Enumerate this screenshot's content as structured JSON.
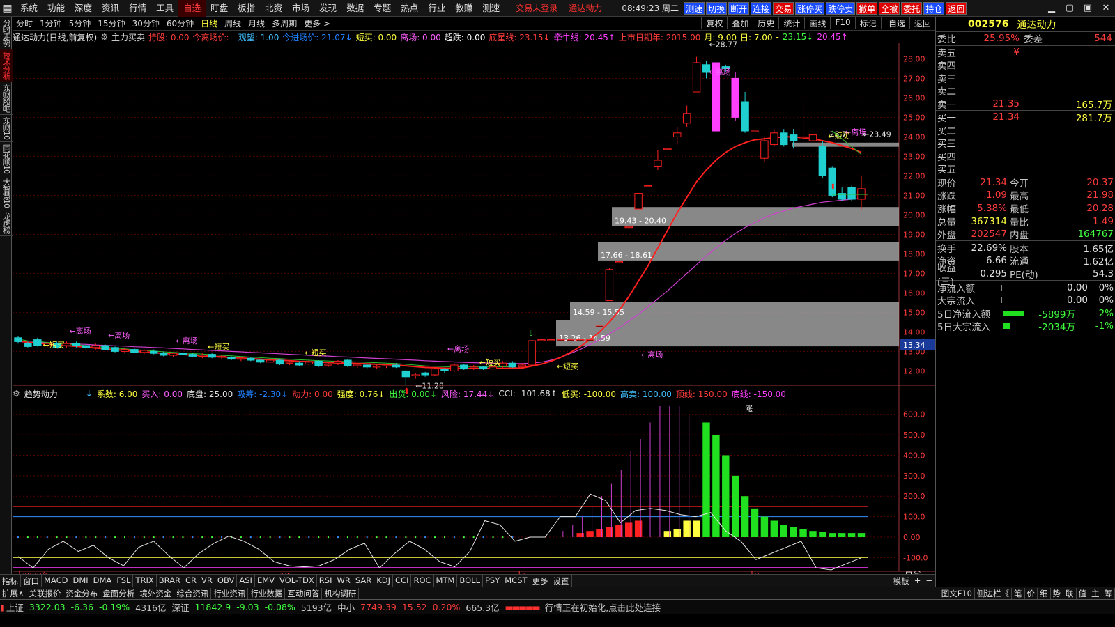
{
  "menu": {
    "items": [
      "系统",
      "功能",
      "深度",
      "资讯",
      "行情",
      "工具",
      "自选",
      "盯盘",
      "板指",
      "北资",
      "市场",
      "发现",
      "数据",
      "专题",
      "热点",
      "行业",
      "教赚",
      "测速"
    ],
    "active": "自选",
    "status1": "交易未登录",
    "status2": "通达动力",
    "clock": "08:49:23",
    "weekday": "周二",
    "quick": [
      "测速",
      "切换",
      "断开",
      "连接",
      "交易",
      "涨停买",
      "跌停卖",
      "撤单",
      "全撤",
      "委托",
      "持仓",
      "返回"
    ],
    "win": [
      "▁",
      "▢",
      "▣",
      "✕"
    ]
  },
  "lefttabs": [
    "分时走势",
    "技术分析",
    "东财股吧",
    "东财10",
    "同花顺10",
    "大智慧10",
    "龙虎榜"
  ],
  "lefttab_active": "技术分析",
  "periods": [
    "分时",
    "1分钟",
    "5分钟",
    "15分钟",
    "30分钟",
    "60分钟",
    "日线",
    "周线",
    "月线",
    "多周期",
    "更多 >"
  ],
  "period_active": "日线",
  "rbuttons": [
    "复权",
    "叠加",
    "历史",
    "统计",
    "画线",
    "F10",
    "标记",
    "-自选",
    "返回"
  ],
  "info": {
    "name": "通达动力(日线,前复权)",
    "fields": [
      {
        "t": "主力买卖",
        "c": "#e0e0e0"
      },
      {
        "t": "持股: 0.00",
        "c": "#ff3c3c"
      },
      {
        "t": "今离场价: -",
        "c": "#ff3c3c"
      },
      {
        "t": "观望: 1.00",
        "c": "#40c0ff"
      },
      {
        "t": "今进场价: 21.07↓",
        "c": "#2080ff"
      },
      {
        "t": "短买: 0.00",
        "c": "#ffff40"
      },
      {
        "t": "离场: 0.00",
        "c": "#ff60ff"
      },
      {
        "t": "超跌: 0.00",
        "c": "#ffffff"
      },
      {
        "t": "底星线: 23.15↓",
        "c": "#ff3c3c"
      },
      {
        "t": "牵牛线: 20.45↑",
        "c": "#ff40ff"
      },
      {
        "t": "上市日期年: 2015.00",
        "c": "#ff3c3c"
      },
      {
        "t": "月: 9.00",
        "c": "#ffff40"
      },
      {
        "t": "日: 7.00",
        "c": "#ffff40"
      },
      {
        "t": "-",
        "c": "#ffff40"
      },
      {
        "t": "23.15↓",
        "c": "#40ff40"
      },
      {
        "t": "20.45↑",
        "c": "#ff40ff"
      }
    ]
  },
  "indicator": {
    "name": "趋势动力",
    "fields": [
      {
        "t": "↓",
        "c": "#40c0ff"
      },
      {
        "t": "系数: 6.00",
        "c": "#ffff40"
      },
      {
        "t": "买入: 0.00",
        "c": "#ff60ff"
      },
      {
        "t": "底盘: 25.00",
        "c": "#e0e0e0"
      },
      {
        "t": "吸筹: -2.30↓",
        "c": "#2080ff"
      },
      {
        "t": "动力: 0.00",
        "c": "#ff3c3c"
      },
      {
        "t": "强度: 0.76↓",
        "c": "#ffff40"
      },
      {
        "t": "出货: 0.00↓",
        "c": "#40ff40"
      },
      {
        "t": "风险: 17.44↓",
        "c": "#ff60ff"
      },
      {
        "t": "CCI: -101.68↑",
        "c": "#e0e0e0"
      },
      {
        "t": "低买: -100.00",
        "c": "#ffff40"
      },
      {
        "t": "高卖: 100.00",
        "c": "#40c0ff"
      },
      {
        "t": "顶线: 150.00",
        "c": "#ff3c3c"
      },
      {
        "t": "底线: -150.00",
        "c": "#ff40ff"
      }
    ]
  },
  "chart_data": {
    "type": "candlestick",
    "y_ticks": [
      "28.00",
      "27.00",
      "26.00",
      "25.00",
      "24.00",
      "23.00",
      "22.00",
      "21.00",
      "20.00",
      "19.00",
      "18.00",
      "17.00",
      "16.00",
      "15.00",
      "14.00",
      "13.00",
      "12.00"
    ],
    "x_labels": [
      "2022年",
      "12",
      "1",
      "2"
    ],
    "current_price_tag": "13.34",
    "candles": [
      [
        13.7,
        13.5,
        13.8,
        13.4
      ],
      [
        13.4,
        13.25,
        13.5,
        13.2
      ],
      [
        13.6,
        13.3,
        13.7,
        13.25
      ],
      [
        13.3,
        13.4,
        13.5,
        13.2
      ],
      [
        13.4,
        13.2,
        13.5,
        13.15
      ],
      [
        13.3,
        13.4,
        13.5,
        13.2
      ],
      [
        13.4,
        13.3,
        13.5,
        13.2
      ],
      [
        13.3,
        13.2,
        13.4,
        13.1
      ],
      [
        13.2,
        13.3,
        13.4,
        13.1
      ],
      [
        13.3,
        13.1,
        13.35,
        13.05
      ],
      [
        13.2,
        13.0,
        13.25,
        12.95
      ],
      [
        13.0,
        13.1,
        13.2,
        12.9
      ],
      [
        13.1,
        12.95,
        13.15,
        12.9
      ],
      [
        12.95,
        13.05,
        13.1,
        12.85
      ],
      [
        13.0,
        12.9,
        13.1,
        12.85
      ],
      [
        12.9,
        12.8,
        13.0,
        12.75
      ],
      [
        12.8,
        12.9,
        12.95,
        12.7
      ],
      [
        12.9,
        12.85,
        13.0,
        12.8
      ],
      [
        12.85,
        12.75,
        12.9,
        12.7
      ],
      [
        12.75,
        12.8,
        12.9,
        12.65
      ],
      [
        12.85,
        12.7,
        12.9,
        12.65
      ],
      [
        12.7,
        12.75,
        12.8,
        12.6
      ],
      [
        12.7,
        12.6,
        12.75,
        12.55
      ],
      [
        12.6,
        12.65,
        12.7,
        12.5
      ],
      [
        12.65,
        12.55,
        12.7,
        12.5
      ],
      [
        12.55,
        12.45,
        12.6,
        12.4
      ],
      [
        12.45,
        12.55,
        12.6,
        12.4
      ],
      [
        12.55,
        12.35,
        12.6,
        12.3
      ],
      [
        12.4,
        12.45,
        12.5,
        12.3
      ],
      [
        12.4,
        12.3,
        12.5,
        12.25
      ],
      [
        12.35,
        12.45,
        12.55,
        12.3
      ],
      [
        12.5,
        12.25,
        12.55,
        12.2
      ],
      [
        12.3,
        12.35,
        12.45,
        12.2
      ],
      [
        12.4,
        12.5,
        12.55,
        12.3
      ],
      [
        12.55,
        12.25,
        12.6,
        12.2
      ],
      [
        12.25,
        12.3,
        12.4,
        12.15
      ],
      [
        12.3,
        12.2,
        12.35,
        12.1
      ],
      [
        12.2,
        12.25,
        12.3,
        12.1
      ],
      [
        12.25,
        12.3,
        12.35,
        12.15
      ],
      [
        12.3,
        12.2,
        12.4,
        12.15
      ],
      [
        12.0,
        11.7,
        12.05,
        11.3
      ],
      [
        11.75,
        11.8,
        11.9,
        11.6
      ],
      [
        11.9,
        11.8,
        11.95,
        11.7
      ],
      [
        11.8,
        12.1,
        12.2,
        11.75
      ],
      [
        12.1,
        12.0,
        12.15,
        11.9
      ],
      [
        12.0,
        12.3,
        12.4,
        11.95
      ],
      [
        12.3,
        12.1,
        12.35,
        12.05
      ],
      [
        12.15,
        12.2,
        12.3,
        12.05
      ],
      [
        12.2,
        12.1,
        12.25,
        12.05
      ],
      [
        12.1,
        12.2,
        12.3,
        12.0
      ],
      [
        12.25,
        12.4,
        12.5,
        12.1
      ],
      [
        12.4,
        12.2,
        12.5,
        12.15
      ],
      [
        12.2,
        12.3,
        12.4,
        12.1
      ],
      [
        12.3,
        13.55,
        13.58,
        12.3
      ],
      [
        13.6,
        13.6,
        13.6,
        13.6
      ],
      [
        13.6,
        13.6,
        13.6,
        13.6
      ],
      [
        13.6,
        13.6,
        13.6,
        13.6
      ],
      [
        13.6,
        13.6,
        13.6,
        13.6
      ],
      [
        13.6,
        13.6,
        13.6,
        13.6
      ],
      [
        13.6,
        13.6,
        13.6,
        13.6
      ],
      [
        14.3,
        14.3,
        14.3,
        14.3
      ],
      [
        15.6,
        17.2,
        17.3,
        15.6
      ],
      [
        17.6,
        17.6,
        17.6,
        17.6
      ],
      [
        19.4,
        19.4,
        19.4,
        19.4
      ],
      [
        20.3,
        21.1,
        21.1,
        20.3
      ],
      [
        21.5,
        21.5,
        21.5,
        21.5
      ],
      [
        22.5,
        22.8,
        23.3,
        22.3
      ],
      [
        23.4,
        23.4,
        23.4,
        23.4
      ],
      [
        24.0,
        24.2,
        24.5,
        23.6
      ],
      [
        24.7,
        25.2,
        25.6,
        24.5
      ],
      [
        26.3,
        27.8,
        28.1,
        26.3
      ],
      [
        27.7,
        27.3,
        27.9,
        27.0
      ],
      [
        27.8,
        24.3,
        27.8,
        24.2
      ],
      [
        27.6,
        27.5,
        27.7,
        27.3
      ],
      [
        27.0,
        25.0,
        27.3,
        24.8
      ],
      [
        25.8,
        24.3,
        26.3,
        24.2
      ],
      [
        24.3,
        24.3,
        24.3,
        24.3
      ],
      [
        22.9,
        23.8,
        24.0,
        22.7
      ],
      [
        23.6,
        24.2,
        24.4,
        23.5
      ],
      [
        24.2,
        23.6,
        24.4,
        23.5
      ],
      [
        24.1,
        23.8,
        24.4,
        23.4
      ],
      [
        24.0,
        24.0,
        25.6,
        23.6
      ],
      [
        23.8,
        24.1,
        24.3,
        23.6
      ],
      [
        23.5,
        22.0,
        23.8,
        21.9
      ],
      [
        22.4,
        21.0,
        22.5,
        20.9
      ],
      [
        21.1,
        20.8,
        21.4,
        20.7
      ],
      [
        21.4,
        20.8,
        21.5,
        20.7
      ],
      [
        20.8,
        21.34,
        21.98,
        20.28
      ]
    ],
    "ma_red": [
      13.55,
      13.46,
      13.43,
      13.38,
      13.33,
      13.3,
      13.26,
      13.22,
      13.17,
      13.13,
      13.09,
      13.05,
      13.01,
      12.98,
      12.94,
      12.9,
      12.87,
      12.84,
      12.81,
      12.78,
      12.75,
      12.72,
      12.69,
      12.66,
      12.63,
      12.6,
      12.57,
      12.55,
      12.52,
      12.49,
      12.47,
      12.45,
      12.43,
      12.41,
      12.4,
      12.38,
      12.36,
      12.34,
      12.32,
      12.3,
      12.26,
      12.22,
      12.18,
      12.16,
      12.14,
      12.13,
      12.12,
      12.12,
      12.12,
      12.12,
      12.13,
      12.14,
      12.15,
      12.25,
      12.35,
      12.5,
      12.7,
      12.95,
      13.25,
      13.6,
      14.0,
      14.5,
      15.1,
      15.8,
      16.6,
      17.4,
      18.3,
      19.2,
      20.1,
      20.9,
      21.7,
      22.3,
      22.8,
      23.2,
      23.5,
      23.7,
      23.85,
      23.9,
      23.95,
      24.0,
      24.0,
      23.95,
      23.9,
      23.8,
      23.7,
      23.55,
      23.4,
      23.2
    ],
    "ma_purple": [
      13.5,
      13.48,
      13.46,
      13.44,
      13.42,
      13.4,
      13.38,
      13.36,
      13.33,
      13.31,
      13.29,
      13.27,
      13.24,
      13.22,
      13.2,
      13.18,
      13.15,
      13.13,
      13.1,
      13.08,
      13.05,
      13.03,
      13.0,
      12.98,
      12.95,
      12.93,
      12.9,
      12.88,
      12.85,
      12.83,
      12.8,
      12.78,
      12.76,
      12.73,
      12.71,
      12.69,
      12.66,
      12.64,
      12.62,
      12.6,
      12.57,
      12.55,
      12.52,
      12.5,
      12.48,
      12.46,
      12.44,
      12.42,
      12.41,
      12.4,
      12.39,
      12.38,
      12.38,
      12.4,
      12.45,
      12.55,
      12.7,
      12.9,
      13.1,
      13.35,
      13.6,
      13.9,
      14.2,
      14.55,
      14.9,
      15.3,
      15.7,
      16.1,
      16.55,
      17.0,
      17.45,
      17.9,
      18.3,
      18.7,
      19.05,
      19.35,
      19.6,
      19.85,
      20.05,
      20.2,
      20.35,
      20.45,
      20.55,
      20.65,
      20.7,
      20.75,
      20.8,
      20.85
    ],
    "gray_bands": [
      [
        13.26,
        14.59,
        "13.26 - 14.59"
      ],
      [
        14.59,
        15.55,
        "14.59 - 15.55"
      ],
      [
        17.66,
        18.61,
        "17.66 - 18.61"
      ],
      [
        19.43,
        20.4,
        "19.43 - 20.40"
      ],
      [
        23.49,
        23.7,
        ""
      ]
    ],
    "labels": [
      {
        "t": "离场",
        "c": "#ff60ff"
      },
      {
        "t": "短买",
        "c": "#ffff40"
      },
      {
        "t": "28.77",
        "c": "#e0e0e0"
      },
      {
        "t": "23.49",
        "c": "#e0e0e0"
      },
      {
        "t": "11.28",
        "c": "#e0e0e0"
      },
      {
        "t": "23.7",
        "c": "#e0e0e0"
      },
      {
        "t": "涨",
        "c": "#fff"
      }
    ],
    "ind_ticks": [
      "600.0",
      "500.0",
      "400.0",
      "300.0",
      "200.0",
      "100.0",
      "0.00",
      "-100.0"
    ],
    "ind_lines": {
      "top": 150,
      "high": 100,
      "low": -100,
      "bottom": -150
    },
    "cci": [
      -95,
      -150,
      -60,
      -20,
      -70,
      -40,
      -100,
      -140,
      -50,
      -20,
      -90,
      -150,
      -80,
      -30,
      5,
      -20,
      -60,
      -120,
      -140,
      -145,
      -140,
      -110,
      -60,
      -30,
      -150,
      -80,
      -20,
      -60,
      -120,
      -145,
      -70,
      80,
      60,
      -20,
      0,
      0,
      100,
      100,
      210,
      180,
      70,
      130,
      140,
      130,
      110,
      100,
      120,
      30,
      -20,
      -110,
      -80,
      -50,
      -20,
      -150,
      -160,
      -130,
      -101
    ]
  },
  "quote": {
    "code": "002576",
    "name": "通达动力",
    "wei_bi": "25.95%",
    "wei_cha": "544",
    "asks": [
      {
        "l": "卖五",
        "p": "¥",
        "q": ""
      },
      {
        "l": "卖四",
        "p": "",
        "q": ""
      },
      {
        "l": "卖三",
        "p": "",
        "q": ""
      },
      {
        "l": "卖二",
        "p": "",
        "q": ""
      },
      {
        "l": "卖一",
        "p": "21.35",
        "q": "165.7万"
      }
    ],
    "bids": [
      {
        "l": "买一",
        "p": "21.34",
        "q": "281.7万"
      },
      {
        "l": "买二",
        "p": "",
        "q": ""
      },
      {
        "l": "买三",
        "p": "",
        "q": ""
      },
      {
        "l": "买四",
        "p": "",
        "q": ""
      },
      {
        "l": "买五",
        "p": "",
        "q": ""
      }
    ],
    "stats": [
      [
        "现价",
        "21.34",
        "今开",
        "20.37"
      ],
      [
        "涨跌",
        "1.09",
        "最高",
        "21.98"
      ],
      [
        "涨幅",
        "5.38%",
        "最低",
        "20.28"
      ],
      [
        "总量",
        "367314",
        "量比",
        "1.49"
      ],
      [
        "外盘",
        "202547",
        "内盘",
        "164767"
      ],
      [
        "换手",
        "22.69%",
        "股本",
        "1.65亿"
      ],
      [
        "净资",
        "6.66",
        "流通",
        "1.62亿"
      ],
      [
        "收益(三)",
        "0.295",
        "PE(动)",
        "54.3"
      ]
    ],
    "flows": [
      [
        "净流入额",
        "0.00",
        "0%"
      ],
      [
        "大宗流入",
        "0.00",
        "0%"
      ],
      [
        "5日净流入额",
        "-5899万",
        "-2%"
      ],
      [
        "5日大宗流入",
        "-2034万",
        "-1%"
      ]
    ],
    "labels": {
      "wei_bi": "委比",
      "wei_cha": "委差"
    }
  },
  "bottom_tabs": [
    "指标",
    "窗口",
    "MACD",
    "DMI",
    "DMA",
    "FSL",
    "TRIX",
    "BRAR",
    "CR",
    "VR",
    "OBV",
    "ASI",
    "EMV",
    "VOL-TDX",
    "RSI",
    "WR",
    "SAR",
    "KDJ",
    "CCI",
    "ROC",
    "MTM",
    "BOLL",
    "PSY",
    "MCST",
    "更多",
    "设置"
  ],
  "bottom_right": [
    "模板",
    "+",
    "−"
  ],
  "ext_tabs": [
    "扩展∧",
    "关联报价",
    "资金分布",
    "盘面分析",
    "境外资金",
    "综合资讯",
    "行业资讯",
    "行业数据",
    "互动问答",
    "机构调研"
  ],
  "ext_right": [
    "图文F10",
    "侧边栏《",
    "笔",
    "价",
    "细",
    "势",
    "联",
    "值",
    "主",
    "筹"
  ],
  "chart_right_label": "日线",
  "status": {
    "sh_label": "上证",
    "sh": "3322.03",
    "sh_chg": "-6.36",
    "sh_pct": "-0.19%",
    "sh_amt": "4316亿",
    "sz_label": "深证",
    "sz": "11842.9",
    "sz_chg": "-9.03",
    "sz_pct": "-0.08%",
    "sz_amt": "5193亿",
    "zx_label": "中小",
    "zx": "7749.39",
    "zx_chg": "15.52",
    "zx_pct": "0.20%",
    "zx_amt": "665.3亿",
    "msg": "行情正在初始化,点击此处连接"
  }
}
